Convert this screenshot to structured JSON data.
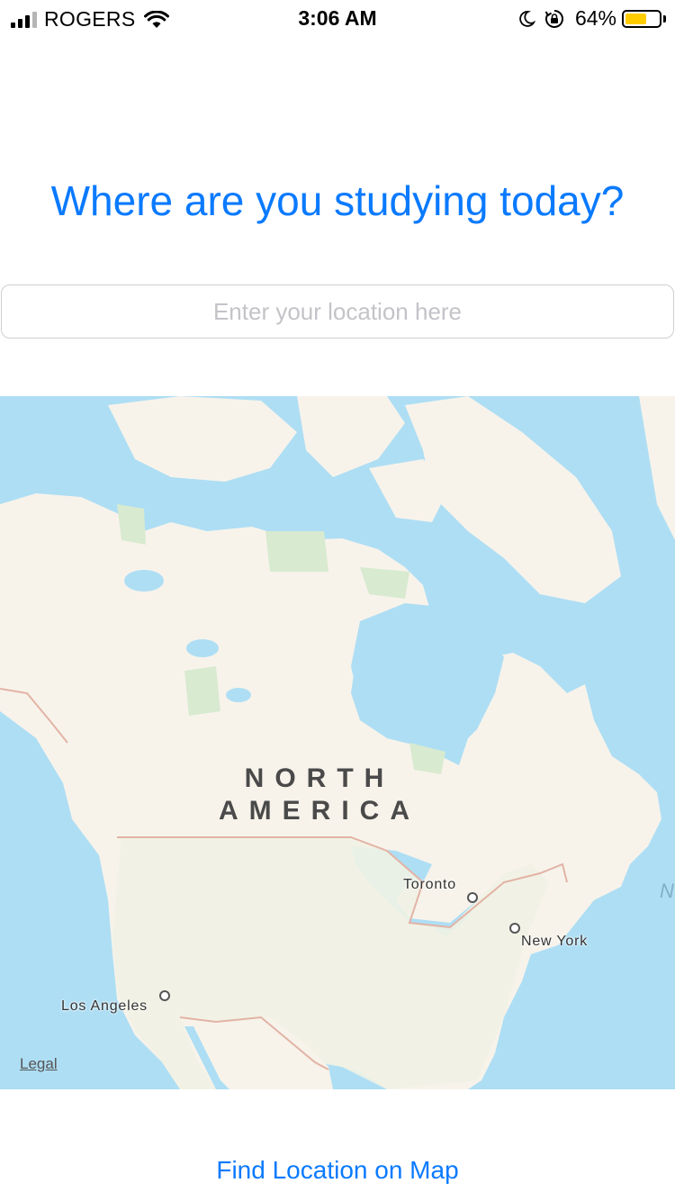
{
  "status_bar": {
    "carrier": "ROGERS",
    "time": "3:06 AM",
    "battery_percent": "64%",
    "battery_level": 0.64,
    "signal_bars_active": 3,
    "signal_bars_total": 4,
    "icons": [
      "signal-icon",
      "wifi-icon",
      "moon-icon",
      "orientation-lock-icon",
      "battery-icon"
    ],
    "battery_color": "#ffcc00"
  },
  "heading": "Where are you studying today?",
  "location_input": {
    "value": "",
    "placeholder": "Enter your location here"
  },
  "map": {
    "continent_line1": "NORTH",
    "continent_line2": "AMERICA",
    "cities": {
      "toronto": "Toronto",
      "new_york": "New York",
      "los_angeles": "Los Angeles"
    },
    "legal": "Legal",
    "edge_label": "N",
    "colors": {
      "water": "#aedef4",
      "land": "#f7f3eb",
      "park": "#d8ead0",
      "border": "#e8b6a4"
    }
  },
  "find_button": "Find Location on Map",
  "accent_color": "#0a7aff"
}
